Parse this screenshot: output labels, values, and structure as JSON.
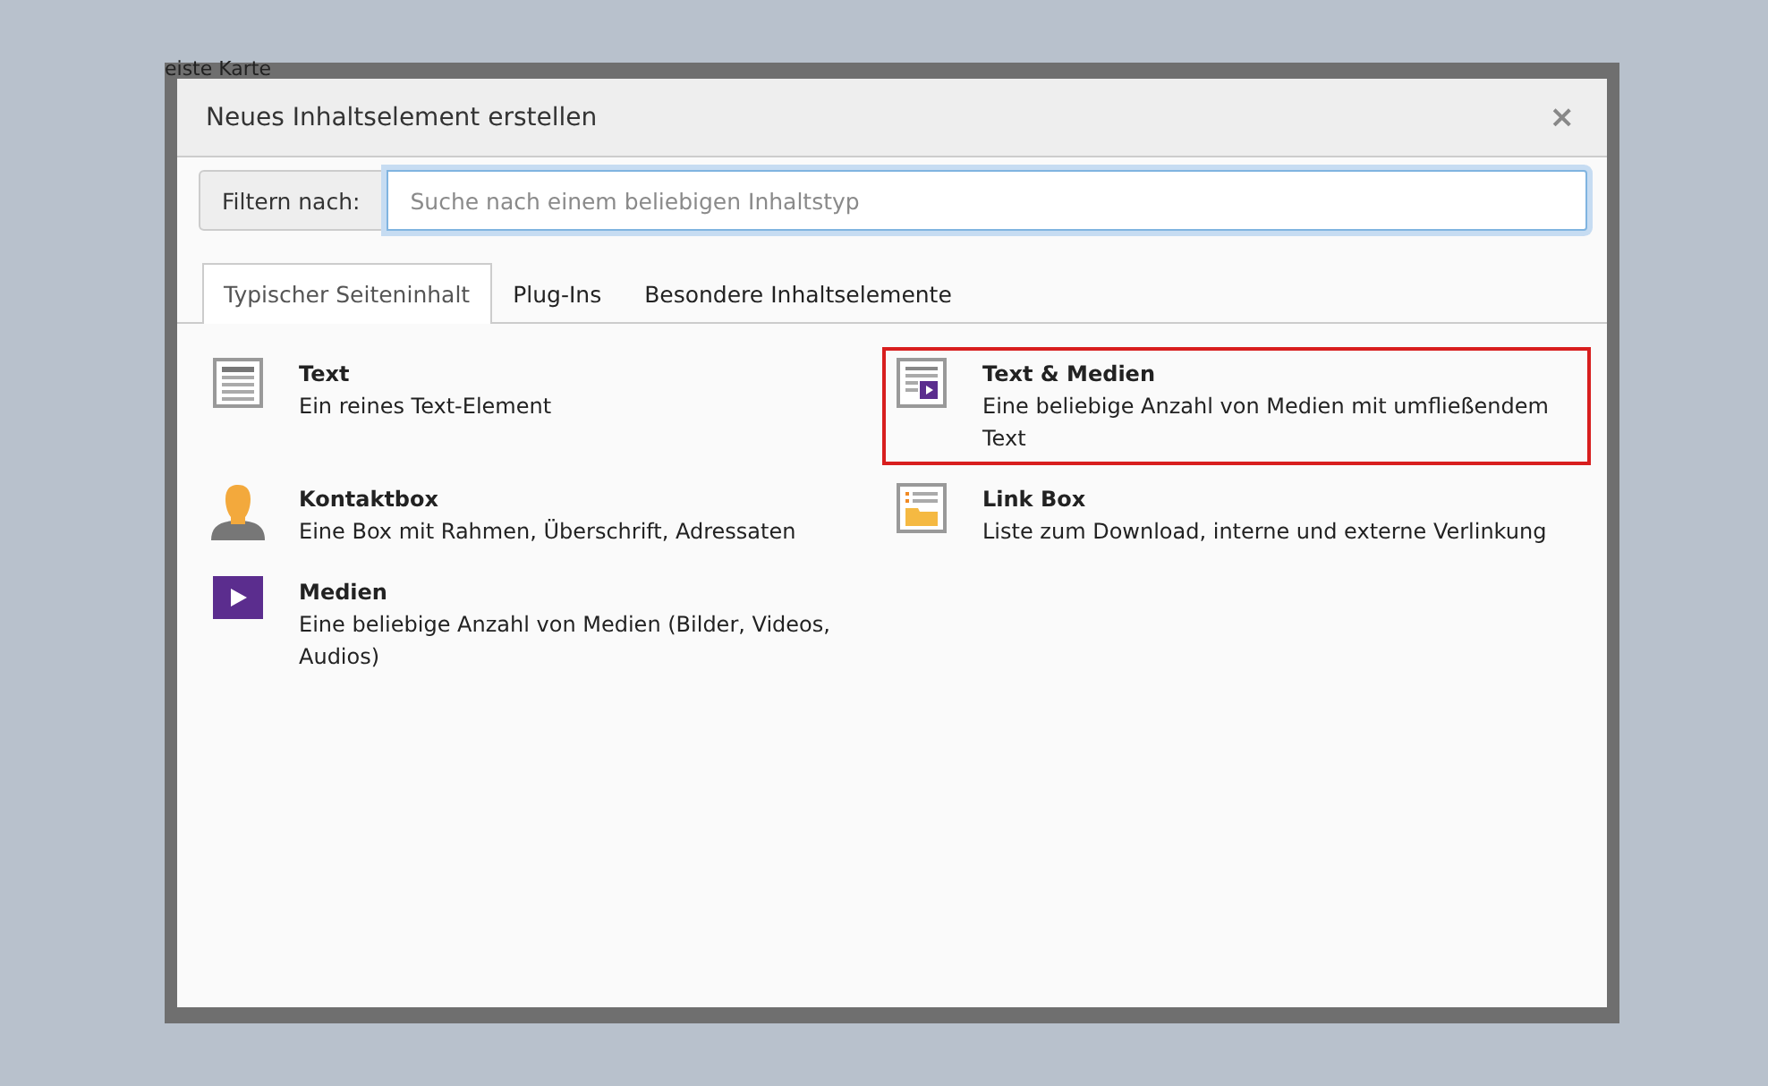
{
  "background": {
    "text": "eiste  Karte"
  },
  "dialog": {
    "title": "Neues Inhaltselement erstellen",
    "close": "×"
  },
  "filter": {
    "label": "Filtern nach:",
    "placeholder": "Suche nach einem beliebigen Inhaltstyp"
  },
  "tabs": [
    {
      "label": "Typischer Seiteninhalt",
      "selected": true
    },
    {
      "label": "Plug-Ins",
      "selected": false
    },
    {
      "label": "Besondere Inhaltselemente",
      "selected": false
    }
  ],
  "elements": [
    {
      "kind": "text",
      "title": "Text",
      "description": "Ein reines Text-Element",
      "selected": false
    },
    {
      "kind": "textmedia",
      "title": "Text & Medien",
      "description": "Eine beliebige Anzahl von Medien mit umfließendem Text",
      "selected": true
    },
    {
      "kind": "person",
      "title": "Kontaktbox",
      "description": "Eine Box mit Rahmen, Überschrift, Adressaten",
      "selected": false
    },
    {
      "kind": "linkbox",
      "title": "Link Box",
      "description": "Liste zum Download, interne und externe Verlinkung",
      "selected": false
    },
    {
      "kind": "media",
      "title": "Medien",
      "description": "Eine beliebige Anzahl von Medien (Bilder, Videos, Audios)",
      "selected": false
    }
  ]
}
